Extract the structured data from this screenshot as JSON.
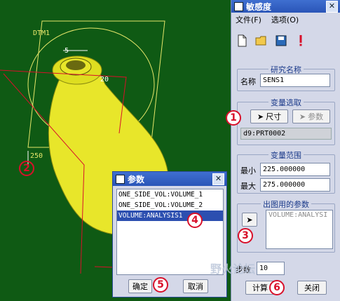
{
  "canvas": {
    "datum_label": "DTM1",
    "dim_small_1": "5",
    "dim_small_2": "20",
    "dim_large": "250",
    "colors": {
      "background": "#0f5a14",
      "model": "#e8e62a",
      "annotation": "#d8102a"
    }
  },
  "annotations": [
    "1",
    "2",
    "3",
    "4",
    "5",
    "6"
  ],
  "sensitivity": {
    "title": "敏感度",
    "close": "✕",
    "menu": [
      "文件(F)",
      "选项(O)"
    ],
    "toolbar_icons": [
      "new-file-icon",
      "open-folder-icon",
      "save-icon",
      "warning-icon"
    ],
    "study_group": {
      "title": "研究名称",
      "name_label": "名称",
      "name_value": "SENS1"
    },
    "var_select": {
      "title": "变量选取",
      "dim_button": "尺寸",
      "param_button": "参数",
      "selected": "d9:PRT0002"
    },
    "var_range": {
      "title": "变量范围",
      "min_label": "最小",
      "min_value": "225.000000",
      "max_label": "最大",
      "max_value": "275.000000"
    },
    "plot_params": {
      "title": "出图用的参数",
      "list_value": "VOLUME:ANALYSI"
    },
    "steps_label": "步数",
    "steps_value": "10",
    "compute_button": "计算",
    "close_button": "关闭"
  },
  "params_dialog": {
    "title": "参数",
    "close": "✕",
    "items": [
      "ONE_SIDE_VOL:VOLUME_1",
      "ONE_SIDE_VOL:VOLUME_2",
      "VOLUME:ANALYSIS1"
    ],
    "selected_index": 2,
    "ok_button": "确定",
    "cancel_button": "取消"
  },
  "watermark": "野火论坛"
}
